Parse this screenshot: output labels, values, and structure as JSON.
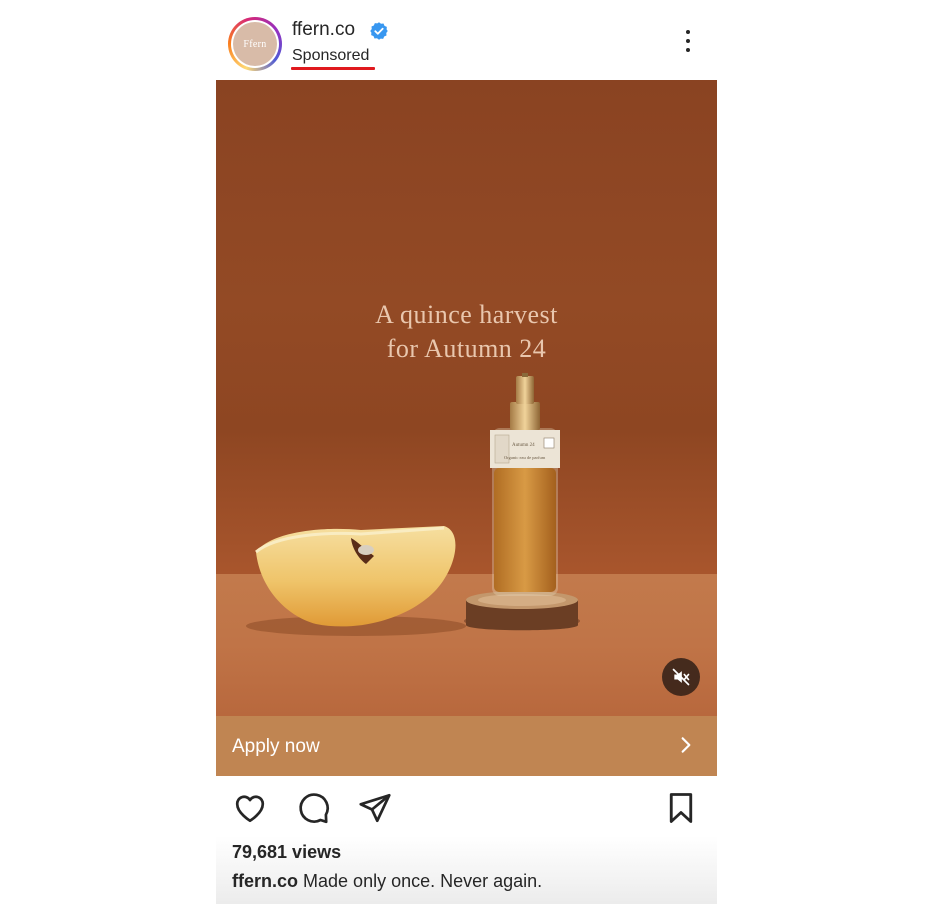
{
  "header": {
    "username": "ffern.co",
    "avatar_text": "Ffern",
    "verified_icon": "verified-badge-icon",
    "sponsored_label": "Sponsored",
    "more_icon": "more-vertical-icon"
  },
  "media": {
    "headline_line1": "A quince harvest",
    "headline_line2": "for Autumn 24",
    "bottle_label_small": "Autumn 24",
    "bottle_label_sub": "Organic eau de parfum",
    "mute_icon": "muted-speaker-icon"
  },
  "cta": {
    "label": "Apply now",
    "arrow_icon": "chevron-right-icon"
  },
  "actions": {
    "like_icon": "heart-icon",
    "comment_icon": "comment-icon",
    "share_icon": "send-icon",
    "save_icon": "bookmark-icon"
  },
  "stats": {
    "views": "79,681 views"
  },
  "caption": {
    "username": "ffern.co",
    "text": "Made only once. Never again."
  },
  "colors": {
    "accent_cta": "#c08552",
    "verified": "#3897f0",
    "sponsored_underline": "#e0191e",
    "background_media": "#8e4622"
  }
}
